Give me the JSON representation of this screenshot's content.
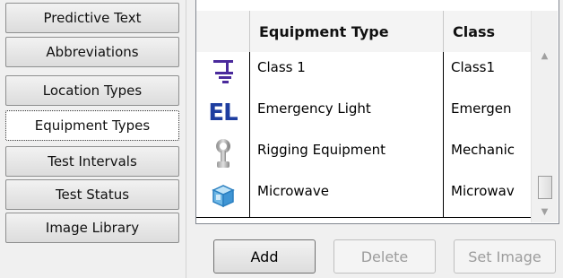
{
  "tabs": [
    {
      "label": "Predictive Text",
      "active": false
    },
    {
      "label": "Abbreviations",
      "active": false
    },
    {
      "label": "Location Types",
      "active": false
    },
    {
      "label": "Equipment Types",
      "active": true
    },
    {
      "label": "Test Intervals",
      "active": false
    },
    {
      "label": "Test Status",
      "active": false
    },
    {
      "label": "Image Library",
      "active": false
    }
  ],
  "grid": {
    "columns": [
      "Equipment Type",
      "Class"
    ],
    "rows": [
      {
        "icon": "ground-symbol-icon",
        "type": "Class 1",
        "class": "Class1"
      },
      {
        "icon": "el-letters-icon",
        "icon_text": "EL",
        "type": "Emergency Light",
        "class": "Emergen"
      },
      {
        "icon": "rigging-hook-icon",
        "type": "Rigging Equipment",
        "class": "Mechanic"
      },
      {
        "icon": "microwave-box-icon",
        "type": "Microwave",
        "class": "Microwav"
      }
    ]
  },
  "buttons": {
    "add": {
      "label": "Add",
      "enabled": true
    },
    "delete": {
      "label": "Delete",
      "enabled": false
    },
    "set_image": {
      "label": "Set Image",
      "enabled": false
    }
  },
  "colors": {
    "icon_blue": "#1e3ea0",
    "ground_purple": "#4a2a9c",
    "disabled_text": "#9c9c9c"
  }
}
